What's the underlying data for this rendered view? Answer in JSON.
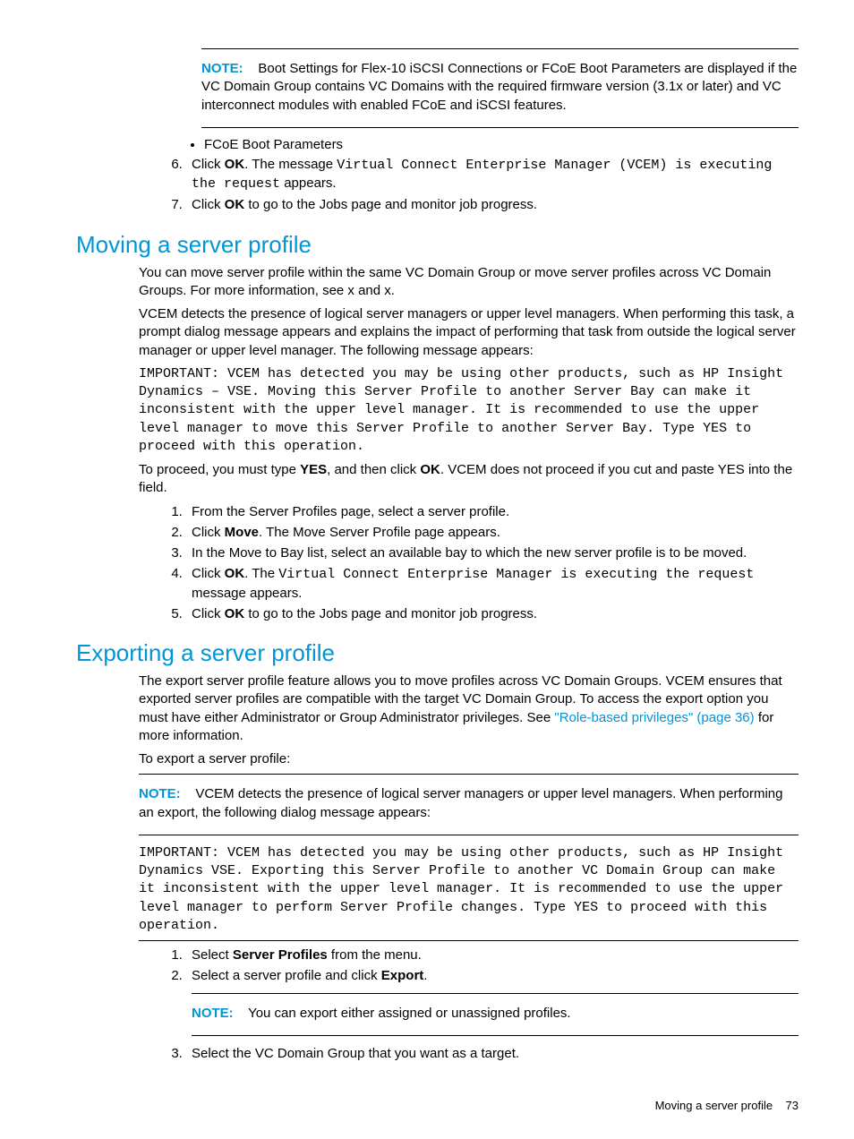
{
  "topNote": {
    "label": "NOTE:",
    "text": "Boot Settings for Flex-10 iSCSI Connections or FCoE Boot Parameters are displayed if the VC Domain Group contains VC Domains with the required firmware version (3.1x or later) and VC interconnect modules with enabled FCoE and iSCSI features."
  },
  "bullet1": "FCoE Boot Parameters",
  "steps_top": {
    "s6_a": "Click ",
    "s6_ok": "OK",
    "s6_b": ". The message ",
    "s6_mono": "Virtual Connect Enterprise Manager (VCEM) is executing the request",
    "s6_c": " appears.",
    "s7_a": "Click ",
    "s7_ok": "OK",
    "s7_b": " to go to the Jobs page and monitor job progress."
  },
  "moving": {
    "heading": "Moving a server profile",
    "p1": "You can move server profile within the same VC Domain Group or move server profiles across VC Domain Groups. For more information, see x and x.",
    "p2": "VCEM detects the presence of logical server managers or upper level managers. When performing this task, a prompt dialog message appears and explains the impact of performing that task from outside the logical server manager or upper level manager. The following message appears:",
    "mono": "IMPORTANT: VCEM has detected you may be using other products, such as HP Insight Dynamics – VSE. Moving this Server Profile to another Server Bay can make it inconsistent with the upper level manager. It is recommended to use the upper level manager to move this Server Profile to another Server Bay. Type YES to proceed with this operation.",
    "p3_a": "To proceed, you must type ",
    "p3_yes": "YES",
    "p3_b": ", and then click ",
    "p3_ok": "OK",
    "p3_c": ". VCEM does not proceed if you cut and paste YES into the field.",
    "steps": {
      "s1": "From the Server Profiles page, select a server profile.",
      "s2_a": "Click ",
      "s2_b": "Move",
      "s2_c": ". The Move Server Profile page appears.",
      "s3": "In the Move to Bay list, select an available bay to which the new server profile is to be moved.",
      "s4_a": "Click ",
      "s4_ok": "OK",
      "s4_b": ". The ",
      "s4_mono": "Virtual Connect Enterprise Manager is executing the request",
      "s4_c": " message appears.",
      "s5_a": "Click ",
      "s5_ok": "OK",
      "s5_b": " to go to the Jobs page and monitor job progress."
    }
  },
  "exporting": {
    "heading": "Exporting a server profile",
    "p1_a": "The export server profile feature allows you to move profiles across VC Domain Groups. VCEM ensures that exported server profiles are compatible with the target VC Domain Group. To access the export option you must have either Administrator or Group Administrator privileges. See ",
    "p1_link": "\"Role-based privileges\" (page 36)",
    "p1_b": " for more information.",
    "p2": "To export a server profile:",
    "note": {
      "label": "NOTE:",
      "text": "VCEM detects the presence of logical server managers or upper level managers. When performing an export, the following dialog message appears:"
    },
    "mono": "IMPORTANT: VCEM has detected you may be using other products, such as HP Insight Dynamics VSE. Exporting this Server Profile to another VC Domain Group can make it inconsistent with the upper level manager. It is recommended to use the upper level manager to perform Server Profile changes. Type YES to proceed with this operation.",
    "steps": {
      "s1_a": "Select ",
      "s1_b": "Server Profiles",
      "s1_c": " from the menu.",
      "s2_a": "Select a server profile and click ",
      "s2_b": "Export",
      "s2_c": ".",
      "note": {
        "label": "NOTE:",
        "text": "You can export either assigned or unassigned profiles."
      },
      "s3": "Select the VC Domain Group that you want as a target."
    }
  },
  "footer": {
    "text": "Moving a server profile",
    "page": "73"
  }
}
